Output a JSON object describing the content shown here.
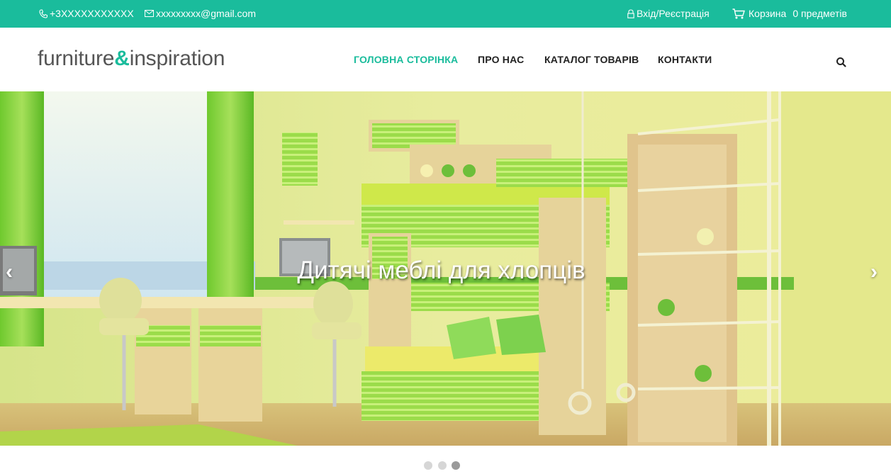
{
  "topbar": {
    "phone": "+3XXXXXXXXXXX",
    "email": "xxxxxxxxx@gmail.com",
    "login": "Вхід/Реєстрація",
    "cart_label": "Корзина",
    "cart_count": "0 предметів"
  },
  "header": {
    "logo_part1": "furniture",
    "logo_amp": "&",
    "logo_part2": "inspiration",
    "nav": [
      {
        "label": "ГОЛОВНА СТОРІНКА",
        "active": true
      },
      {
        "label": "ПРО НАС",
        "active": false
      },
      {
        "label": "КАТАЛОГ ТОВАРІВ",
        "active": false
      },
      {
        "label": "КОНТАКТИ",
        "active": false
      }
    ]
  },
  "slider": {
    "caption": "Дитячі меблі для хлопців",
    "prev_label": "‹",
    "next_label": "›",
    "slide_count": 3,
    "active_slide": 3
  },
  "colors": {
    "accent": "#1abc9c",
    "nav_text": "#222222",
    "logo_text": "#555555"
  },
  "icons": [
    "phone-icon",
    "mail-icon",
    "lock-icon",
    "cart-icon",
    "search-icon"
  ]
}
